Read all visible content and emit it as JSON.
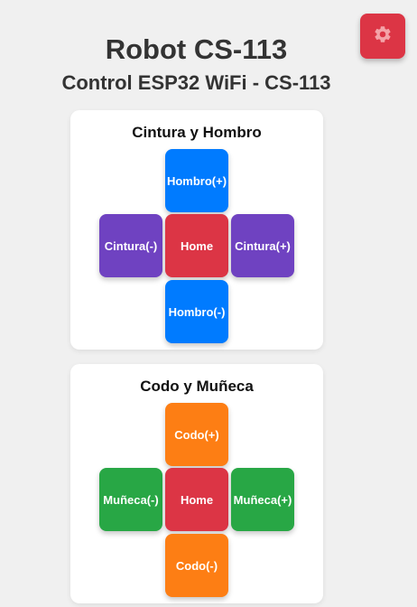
{
  "header": {
    "title": "Robot CS-113",
    "subtitle": "Control ESP32 WiFi - CS-113"
  },
  "settings": {
    "icon": "gear-icon"
  },
  "colors": {
    "blue": "#007bff",
    "red": "#dc3545",
    "purple": "#6f42c1",
    "orange": "#fd7e14",
    "green": "#28a745"
  },
  "panels": [
    {
      "title": "Cintura y Hombro",
      "up": "Hombro(+)",
      "left": "Cintura(-)",
      "center": "Home",
      "right": "Cintura(+)",
      "down": "Hombro(-)"
    },
    {
      "title": "Codo y Muñeca",
      "up": "Codo(+)",
      "left": "Muñeca(-)",
      "center": "Home",
      "right": "Muñeca(+)",
      "down": "Codo(-)"
    }
  ]
}
